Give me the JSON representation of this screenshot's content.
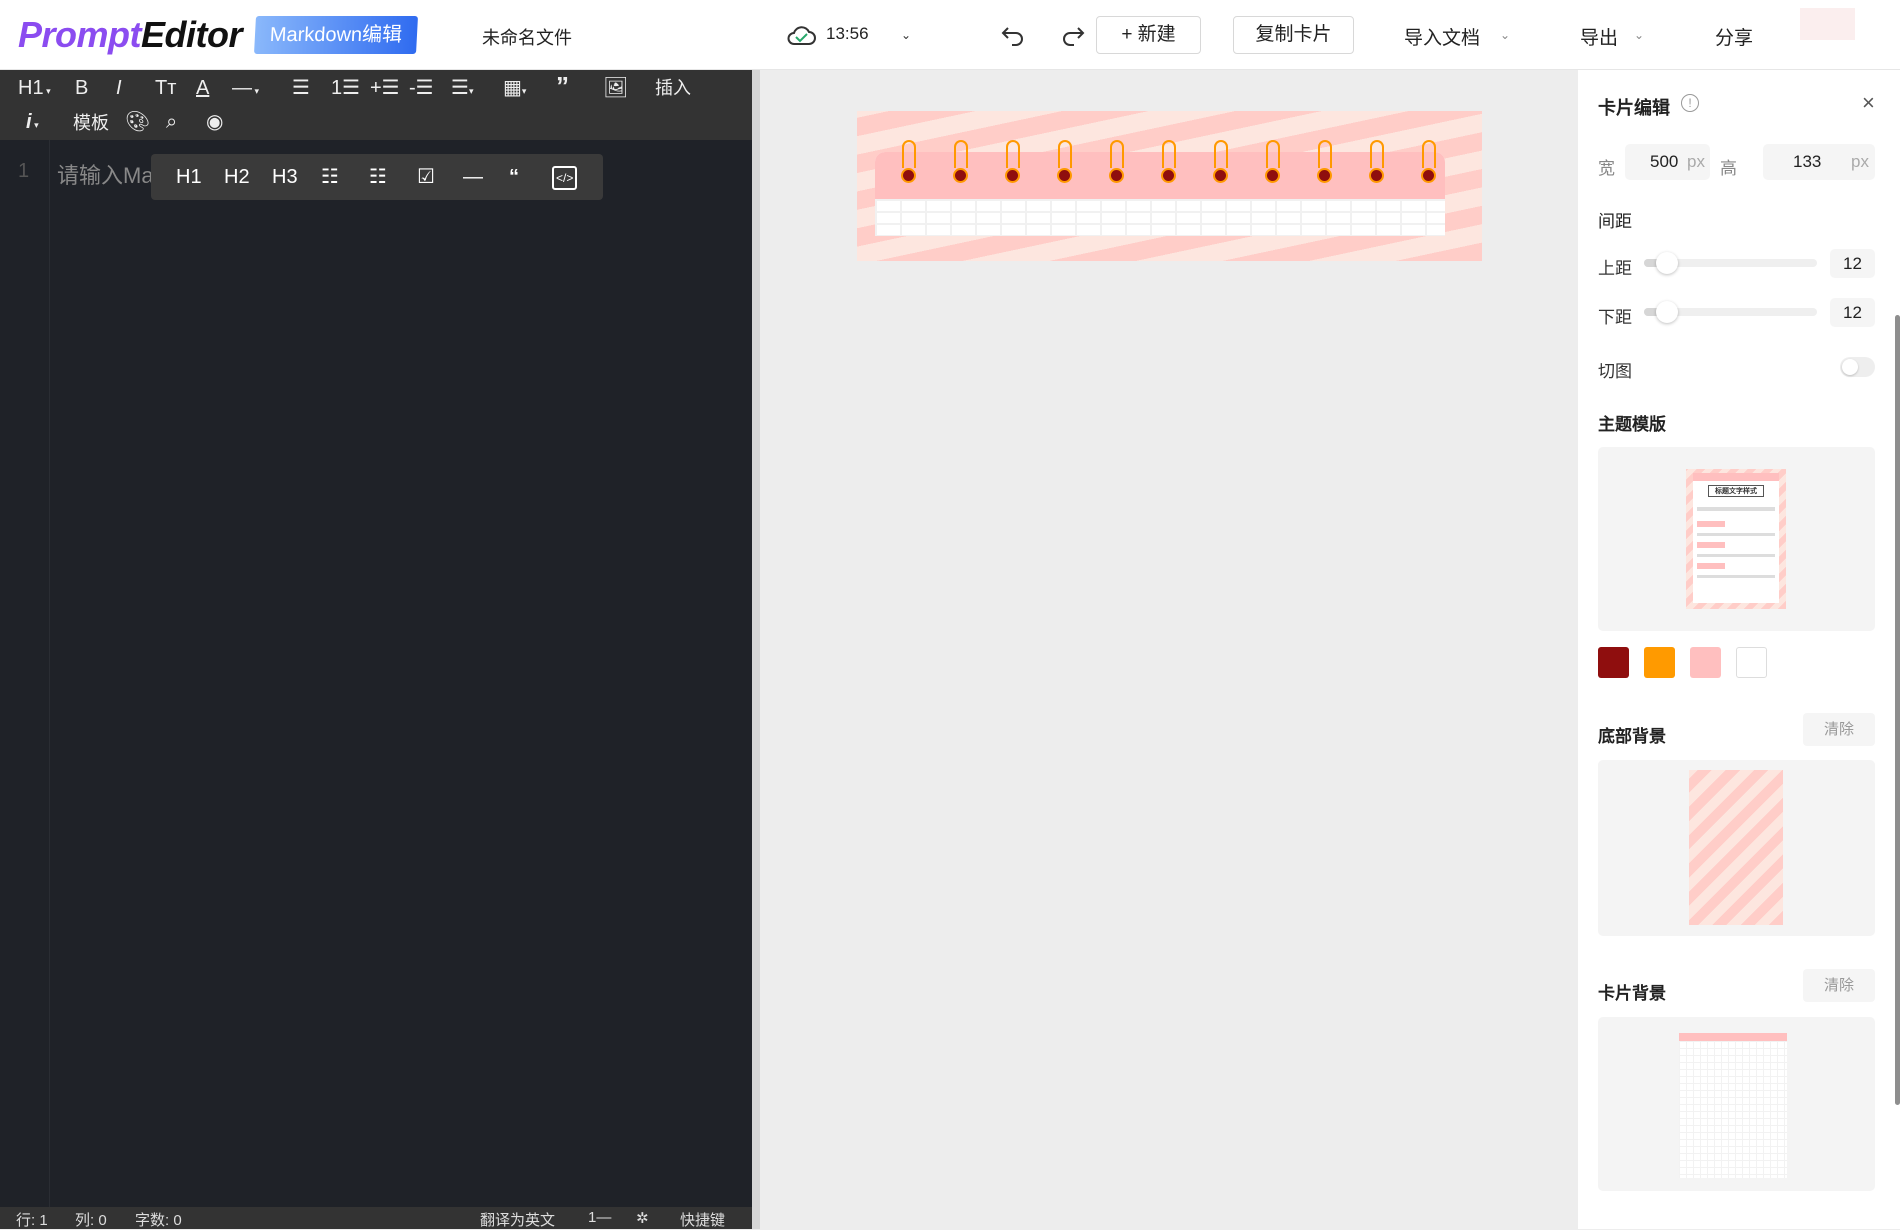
{
  "header": {
    "logo_part1": "Prompt",
    "logo_part2": "Editor",
    "mode_badge": "Markdown编辑",
    "filename": "未命名文件",
    "save_time": "13:56",
    "new_label": "+ 新建",
    "copy_card_label": "复制卡片",
    "import_label": "导入文档",
    "export_label": "导出",
    "share_label": "分享"
  },
  "toolbar": {
    "insert_label": "插入",
    "template_label": "模板",
    "heading_label": "H1"
  },
  "editor": {
    "line_number": "1",
    "placeholder": "请输入Ma"
  },
  "float_toolbar": {
    "h1": "H1",
    "h2": "H2",
    "h3": "H3"
  },
  "status": {
    "line": "行: 1",
    "col": "列: 0",
    "words": "字数: 0",
    "translate": "翻译为英文",
    "line_mode": "1—",
    "shortcuts": "快捷键"
  },
  "panel": {
    "title": "卡片编辑",
    "width_label": "宽",
    "width_value": "500",
    "height_label": "高",
    "height_value": "133",
    "unit": "px",
    "spacing_title": "间距",
    "top_label": "上距",
    "top_value": "12",
    "bottom_label": "下距",
    "bottom_value": "12",
    "slider_fraction": 0.12,
    "crop_label": "切图",
    "crop_on": false,
    "theme_title": "主题模版",
    "theme_preview_title": "标题文字样式",
    "bottom_bg_title": "底部背景",
    "card_bg_title": "卡片背景",
    "clear_label": "清除"
  },
  "colors": {
    "swatches": [
      "#8f0e0e",
      "#ff9a00",
      "#ffbfbf",
      "#ffffff"
    ],
    "accent": "#2f6bf0"
  }
}
